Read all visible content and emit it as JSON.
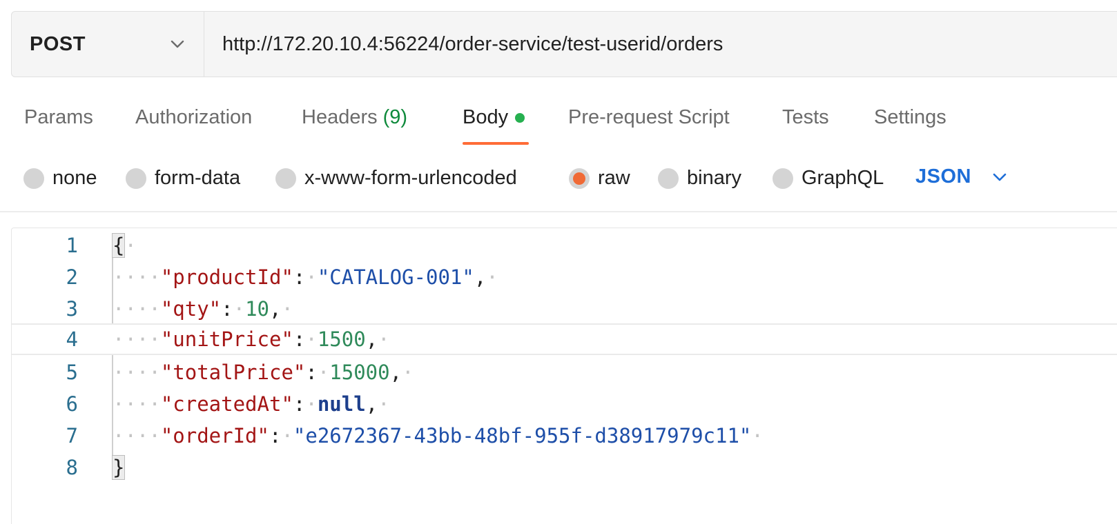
{
  "request": {
    "method": "POST",
    "url": "http://172.20.10.4:56224/order-service/test-userid/orders"
  },
  "tabs": [
    {
      "label": "Params"
    },
    {
      "label": "Authorization"
    },
    {
      "label": "Headers",
      "count": "(9)"
    },
    {
      "label": "Body",
      "active": true
    },
    {
      "label": "Pre-request Script"
    },
    {
      "label": "Tests"
    },
    {
      "label": "Settings"
    }
  ],
  "body_types": [
    {
      "label": "none"
    },
    {
      "label": "form-data"
    },
    {
      "label": "x-www-form-urlencoded"
    },
    {
      "label": "raw",
      "checked": true
    },
    {
      "label": "binary"
    },
    {
      "label": "GraphQL"
    }
  ],
  "language": "JSON",
  "editor": {
    "lines": [
      {
        "number": "1"
      },
      {
        "number": "2",
        "key": "\"productId\"",
        "value": "\"CATALOG-001\""
      },
      {
        "number": "3",
        "key": "\"qty\"",
        "value": "10"
      },
      {
        "number": "4",
        "key": "\"unitPrice\"",
        "value": "1500"
      },
      {
        "number": "5",
        "key": "\"totalPrice\"",
        "value": "15000"
      },
      {
        "number": "6",
        "key": "\"createdAt\"",
        "value": "null"
      },
      {
        "number": "7",
        "key": "\"orderId\"",
        "value": "\"e2672367-43bb-48bf-955f-d38917979c11\""
      },
      {
        "number": "8"
      }
    ],
    "open_brace": "{",
    "close_brace": "}"
  },
  "colors": {
    "accent": "#ff6c37",
    "radio_checked": "#f06a36",
    "body_dot": "#26b050",
    "headers_count": "#0f8a3c",
    "language_link": "#1e6ed8",
    "json_key": "#a31515",
    "json_string": "#1d4ea8",
    "json_number": "#2f8a5a"
  },
  "icons": {
    "method_dropdown": "chevron-down-icon",
    "language_dropdown": "chevron-down-icon"
  }
}
